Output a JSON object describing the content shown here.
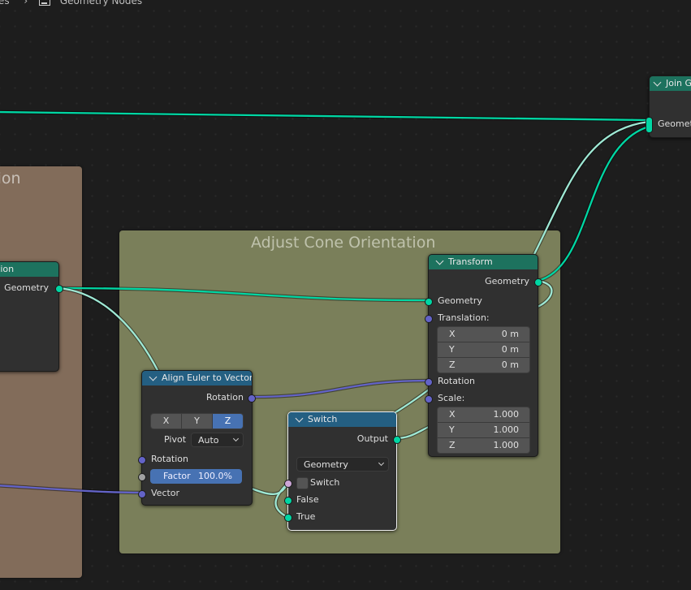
{
  "breadcrumb": {
    "items": [
      "Nodes",
      "Geometry Nodes"
    ],
    "icons": [
      "chevron-right-icon",
      "node-tree-icon"
    ]
  },
  "frames": {
    "position": {
      "title": "Position",
      "visible_title": "sition",
      "color": "#826c5a"
    },
    "adjust": {
      "title": "Adjust Cone Orientation",
      "color": "#7a7f5a"
    }
  },
  "nodes": {
    "set_position": {
      "title": "Set Position",
      "visible_title": "ition",
      "outputs": [
        {
          "label": "Geometry",
          "type": "geometry"
        }
      ]
    },
    "join_geometry": {
      "title": "Join Geometry",
      "visible_title": "Join G",
      "inputs": [
        {
          "label": "Geometry",
          "visible_label": "Geomet",
          "type": "geometry"
        }
      ]
    },
    "align_euler": {
      "title": "Align Euler to Vector",
      "outputs": [
        {
          "label": "Rotation",
          "type": "vector"
        }
      ],
      "axis": {
        "options": [
          "X",
          "Y",
          "Z"
        ],
        "selected": "Z"
      },
      "pivot": {
        "label": "Pivot",
        "value": "Auto"
      },
      "inputs": [
        {
          "label": "Rotation",
          "type": "vector"
        },
        {
          "label": "Factor",
          "value": "100.0%",
          "type": "float"
        },
        {
          "label": "Vector",
          "type": "vector"
        }
      ]
    },
    "switch": {
      "title": "Switch",
      "outputs": [
        {
          "label": "Output",
          "type": "geometry"
        }
      ],
      "type_dropdown": "Geometry",
      "inputs": [
        {
          "label": "Switch",
          "type": "boolean",
          "checked": false
        },
        {
          "label": "False",
          "type": "geometry"
        },
        {
          "label": "True",
          "type": "geometry"
        }
      ]
    },
    "transform": {
      "title": "Transform",
      "outputs": [
        {
          "label": "Geometry",
          "type": "geometry"
        }
      ],
      "inputs": {
        "geometry": "Geometry",
        "translation": {
          "label": "Translation:",
          "x": "0 m",
          "y": "0 m",
          "z": "0 m"
        },
        "rotation": "Rotation",
        "scale": {
          "label": "Scale:",
          "x": "1.000",
          "y": "1.000",
          "z": "1.000"
        }
      },
      "axis_labels": [
        "X",
        "Y",
        "Z"
      ]
    }
  },
  "colors": {
    "geometry_socket": "#00d6a3",
    "vector_socket": "#6363c7",
    "boolean_socket": "#cca6d6",
    "float_socket": "#a1a1a1",
    "geometry_header": "#1d725e",
    "vector_header": "#245f82",
    "active_button": "#4772b3"
  }
}
